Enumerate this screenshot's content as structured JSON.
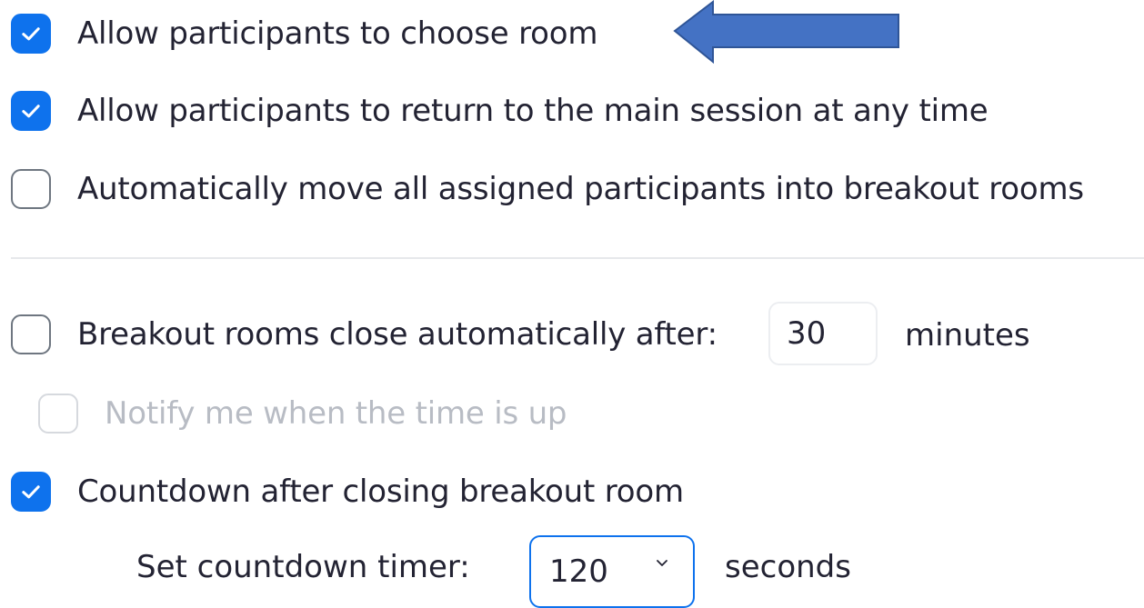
{
  "options": {
    "choose_room": {
      "label": "Allow participants to choose room",
      "checked": true
    },
    "return_main": {
      "label": "Allow participants to return to the main session at any time",
      "checked": true
    },
    "auto_move": {
      "label": "Automatically move all assigned participants into breakout rooms",
      "checked": false
    },
    "auto_close": {
      "label": "Breakout rooms close automatically after:",
      "checked": false,
      "value": "30",
      "unit": "minutes"
    },
    "notify": {
      "label": "Notify me when the time is up",
      "checked": false,
      "disabled": true
    },
    "countdown": {
      "label": "Countdown after closing breakout room",
      "checked": true
    }
  },
  "countdown_timer": {
    "label": "Set countdown timer:",
    "selected": "120",
    "unit": "seconds"
  },
  "colors": {
    "accent": "#0e72ed",
    "arrow": "#4472c4",
    "text": "#232333",
    "disabled_text": "#b8bcc4"
  },
  "icons": {
    "check": "check-icon",
    "dropdown": "chevron-down-icon",
    "pointer": "arrow-left-icon"
  }
}
